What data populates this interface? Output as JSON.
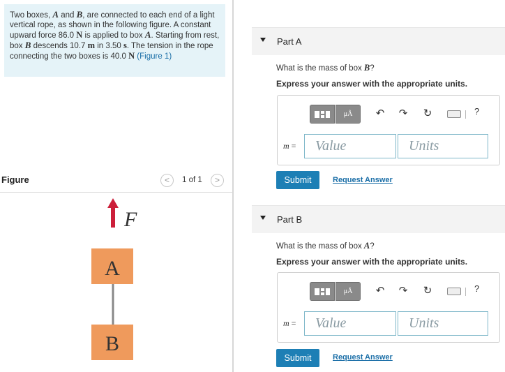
{
  "problem": {
    "t1": "Two boxes, ",
    "A": "A",
    "t2": " and ",
    "B": "B",
    "t3": ", are connected to each end of a light vertical rope, as shown in the following figure. A constant upward force 86.0 ",
    "unit_N1": "N",
    "t4": " is applied to box ",
    "A2": "A",
    "t5": ". Starting from rest, box ",
    "B2": "B",
    "t6": " descends 10.7 ",
    "unit_m": "m",
    "t7": " in 3.50 ",
    "unit_s": "s",
    "t8": ". The tension in the rope connecting the two boxes is 40.0 ",
    "unit_N2": "N",
    "figure_link": "(Figure 1)"
  },
  "figure": {
    "title": "Figure",
    "prev_icon": "chevron-left-icon",
    "next_icon": "chevron-right-icon",
    "prev_glyph": "<",
    "next_glyph": ">",
    "counter": "1 of 1",
    "force_label": "F",
    "box_a_label": "A",
    "box_b_label": "B",
    "arrow_color": "#cc1f3a",
    "box_color": "#ef9a5c",
    "rope_color": "#888888"
  },
  "parts": [
    {
      "title": "Part A",
      "question_pre": "What is the mass of box ",
      "question_var": "B",
      "question_post": "?",
      "instruction": "Express your answer with the appropriate units.",
      "symbol_label": "m",
      "equals": " =",
      "value_placeholder": "Value",
      "units_placeholder": "Units",
      "toolbar_mu": "μÅ",
      "help": "?",
      "submit": "Submit",
      "request": "Request Answer"
    },
    {
      "title": "Part B",
      "question_pre": "What is the mass of box ",
      "question_var": "A",
      "question_post": "?",
      "instruction": "Express your answer with the appropriate units.",
      "symbol_label": "m",
      "equals": " =",
      "value_placeholder": "Value",
      "units_placeholder": "Units",
      "toolbar_mu": "μÅ",
      "help": "?",
      "submit": "Submit",
      "request": "Request Answer"
    }
  ],
  "colors": {
    "accent": "#1d7fb5",
    "link": "#1a6ea7",
    "problem_bg": "#e5f3f8",
    "toolbar": "#8a8a8a"
  }
}
